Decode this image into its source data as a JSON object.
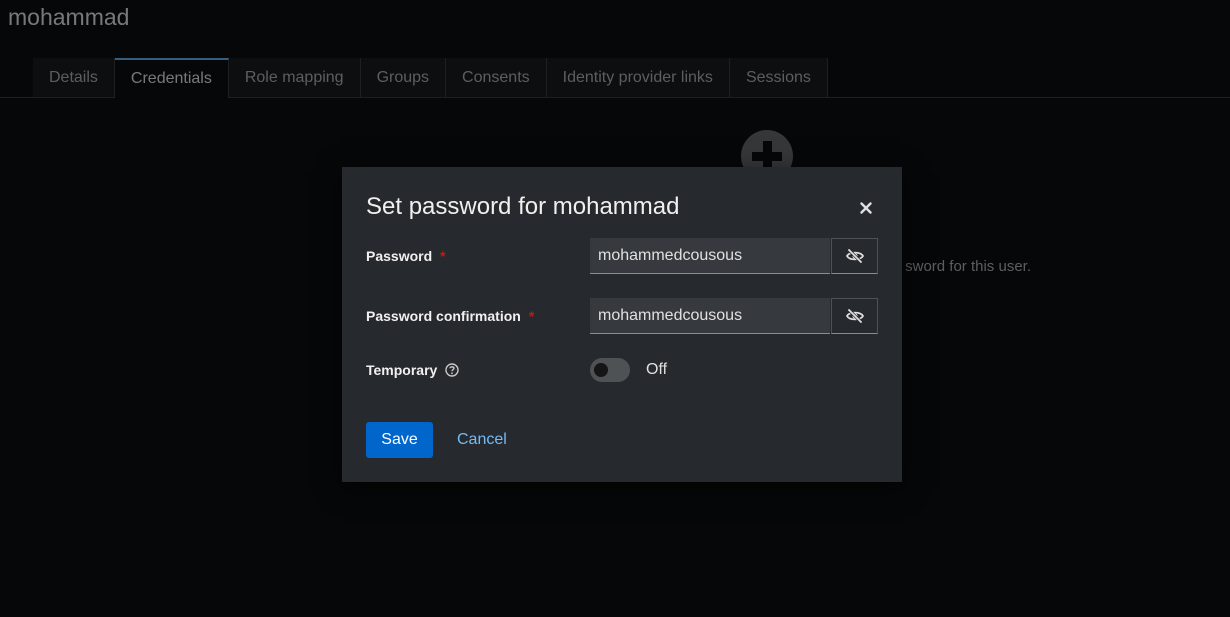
{
  "page": {
    "title": "mohammad",
    "tabs": [
      {
        "label": "Details",
        "active": false
      },
      {
        "label": "Credentials",
        "active": true
      },
      {
        "label": "Role mapping",
        "active": false
      },
      {
        "label": "Groups",
        "active": false
      },
      {
        "label": "Consents",
        "active": false
      },
      {
        "label": "Identity provider links",
        "active": false
      },
      {
        "label": "Sessions",
        "active": false
      }
    ],
    "empty_state": {
      "icon": "plus-circle-icon",
      "text": "sword for this user."
    }
  },
  "modal": {
    "title": "Set password for mohammad",
    "close_icon": "close-icon",
    "password": {
      "label": "Password",
      "required": "*",
      "value": "mohammedcousous",
      "toggle_icon": "eye-slash-icon"
    },
    "password_confirmation": {
      "label": "Password confirmation",
      "required": "*",
      "value": "mohammedcousous",
      "toggle_icon": "eye-slash-icon"
    },
    "temporary": {
      "label": "Temporary",
      "help_icon": "question-circle-icon",
      "state_label": "Off",
      "checked": false
    },
    "save_label": "Save",
    "cancel_label": "Cancel"
  },
  "colors": {
    "primary": "#0066cc",
    "link": "#73bcf7",
    "required": "#c9190b",
    "modal_bg": "#26292d",
    "page_bg": "#0d0e10"
  }
}
